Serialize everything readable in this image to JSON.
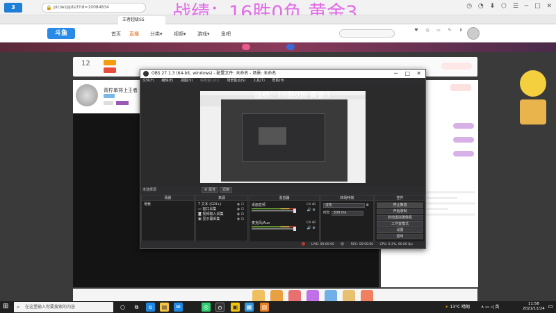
{
  "browser": {
    "logo": "3",
    "nav": [
      "◀",
      "▶",
      "↻"
    ],
    "address": "pic/wzppts3?id=10084834",
    "address_prefix": "gamiev",
    "tabs": [
      {
        "label": "王者超级SS",
        "active": true
      },
      {
        "label": "",
        "active": false
      }
    ],
    "overlay_title": "战绩：16胜0负 黄金3",
    "chrome_icons": [
      "◷",
      "◔",
      "⬇",
      "⬡",
      "☰",
      "─",
      "□",
      "✕"
    ]
  },
  "site": {
    "logo": "斗鱼",
    "nav": [
      "首页",
      "直播",
      "分类▾",
      "视频▾",
      "游戏▾",
      "鱼吧"
    ],
    "header_icons": [
      "关注",
      "历史",
      "客户端",
      "创作",
      "下载"
    ],
    "banner_buttons": [
      "",
      "",
      ""
    ],
    "room_number": "12",
    "streamer_name": "青柠单排上王者"
  },
  "obs": {
    "title": "OBS 27.1.3 (64-bit, windows) - 配置文件: 未命名 - 场景: 未命名",
    "window_controls": [
      "─",
      "□",
      "✕"
    ],
    "menu": [
      "文件(F)",
      "编辑(E)",
      "视图(V)",
      "停靠窗口(D)",
      "场景集合(S)",
      "工具(T)",
      "帮助(H)"
    ],
    "preview_overlay": "战绩：16胜0负 黄金3",
    "toolbar": {
      "no_source_label": "未选择源",
      "properties": "⚙ 属性",
      "filters": "滤镜"
    },
    "docks": {
      "scenes": {
        "title": "场景",
        "items": [
          "场景"
        ]
      },
      "sources": {
        "title": "来源",
        "items": [
          "文本 (GDI+)",
          "窗口采集",
          "视频输入采集",
          "显示器采集"
        ]
      },
      "mixer": {
        "title": "混音器",
        "channels": [
          {
            "name": "桌面音频",
            "db": "0.0 dB"
          },
          {
            "name": "麦克风/Aux",
            "db": "0.0 dB"
          }
        ]
      },
      "transitions": {
        "title": "转场特效",
        "type": "淡化",
        "duration_label": "时长",
        "duration": "300 ms"
      },
      "controls": {
        "title": "控件",
        "buttons": [
          "停止推流",
          "开始录制",
          "启动虚拟摄像机",
          "工作室模式",
          "设置",
          "退出"
        ]
      }
    },
    "footer_buttons": [
      "+",
      "−",
      "∧",
      "∨"
    ],
    "sources_footer": [
      "+",
      "−",
      "⚙",
      "∧",
      "∨"
    ],
    "status": {
      "live": "LIVE: 00:00:00",
      "rec": "REC: 00:00:00",
      "cpu": "CPU: 0.3%, 60.00 fps"
    }
  },
  "taskbar": {
    "start": "⊞",
    "search_placeholder": "在这里输入你要搜索的内容",
    "apps": [
      "○",
      "⧉",
      "e",
      "▤",
      "✉",
      "◎",
      "⊙",
      "▣",
      "▦",
      "▧",
      "▩"
    ],
    "weather": "13°C 晴朗",
    "tray": "∧ ▭ ◁ 英",
    "time": "11:58",
    "date": "2021/11/24"
  },
  "colors": {
    "overlay": "#e36ce8",
    "obs_bg": "#2d2d30",
    "accent": "#2a8ae8"
  }
}
